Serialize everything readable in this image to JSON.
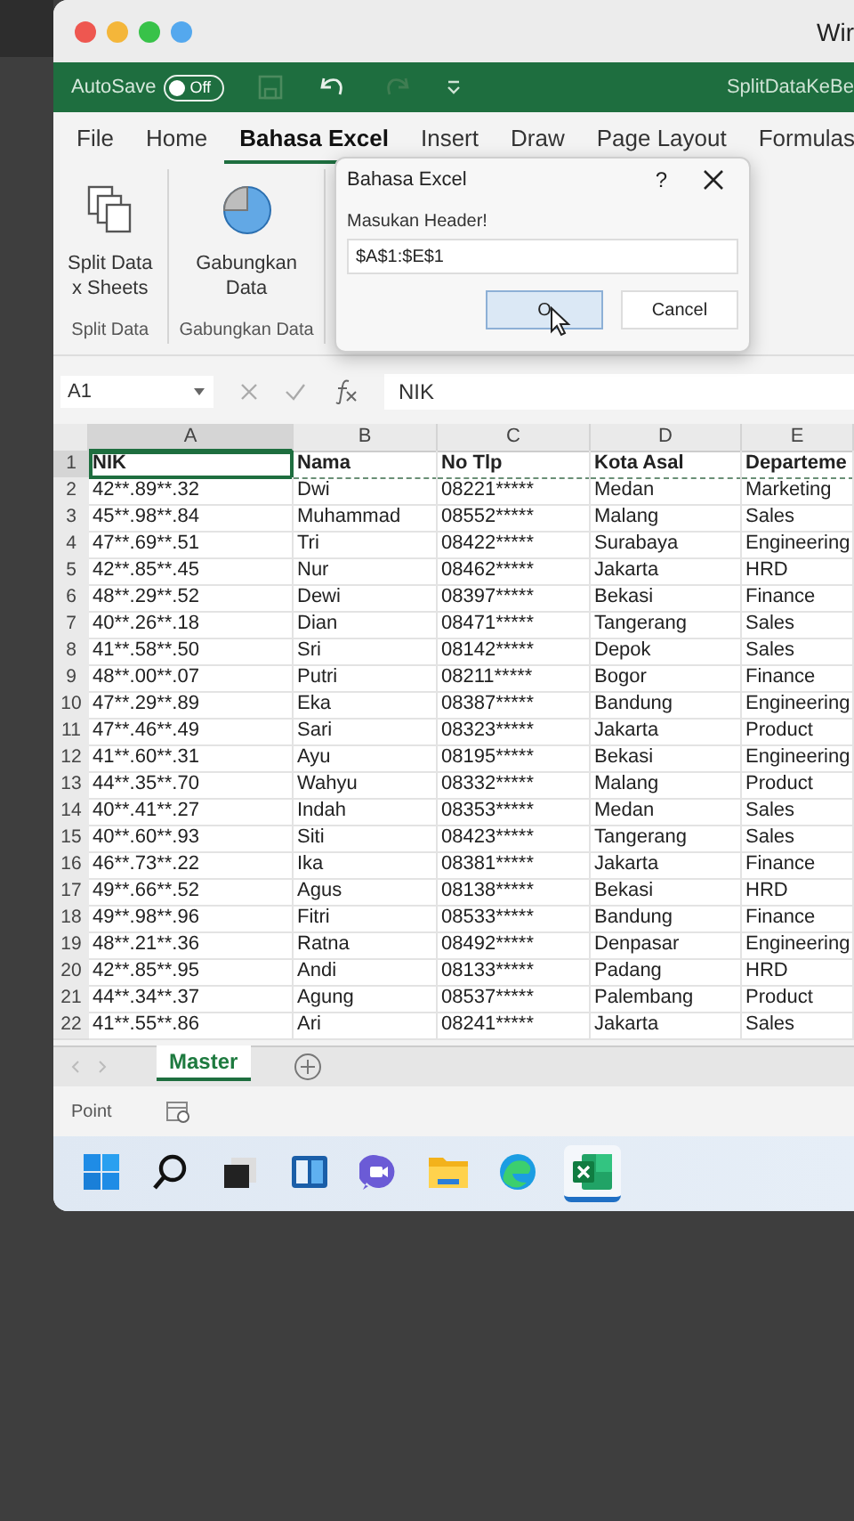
{
  "window": {
    "title": "Wir"
  },
  "quick_access": {
    "autosave_label": "AutoSave",
    "autosave_on": false,
    "autosave_state": "Off",
    "document_title": "SplitDataKeBe"
  },
  "ribbon_tabs": [
    {
      "label": "File",
      "selected": false
    },
    {
      "label": "Home",
      "selected": false
    },
    {
      "label": "Bahasa Excel",
      "selected": true
    },
    {
      "label": "Insert",
      "selected": false
    },
    {
      "label": "Draw",
      "selected": false
    },
    {
      "label": "Page Layout",
      "selected": false
    },
    {
      "label": "Formulas",
      "selected": false
    }
  ],
  "ribbon_groups": [
    {
      "kind": "sheets",
      "button_lines": [
        "Split Data",
        "x Sheets"
      ],
      "group_label": "Split Data"
    },
    {
      "kind": "pie",
      "button_lines": [
        "Gabungkan",
        "Data"
      ],
      "group_label": "Gabungkan Data"
    }
  ],
  "dialog": {
    "title": "Bahasa Excel",
    "help": "?",
    "prompt": "Masukan Header!",
    "value": "$A$1:$E$1",
    "buttons": [
      {
        "label": "O",
        "kind": "primary"
      },
      {
        "label": "Cancel",
        "kind": "secondary"
      }
    ]
  },
  "formula_bar": {
    "name_box": "A1",
    "formula": "NIK"
  },
  "sheet": {
    "columns": [
      {
        "letter": "A",
        "selected": true
      },
      {
        "letter": "B",
        "selected": false
      },
      {
        "letter": "C",
        "selected": false
      },
      {
        "letter": "D",
        "selected": false
      },
      {
        "letter": "E",
        "selected": false
      }
    ],
    "rows": [
      {
        "number": "1",
        "selected": true,
        "kind": "header",
        "cells": [
          "NIK",
          "Nama",
          "No Tlp",
          "Kota Asal",
          "Departeme"
        ]
      },
      {
        "number": "2",
        "selected": false,
        "kind": "data",
        "cells": [
          "42**.89**.32",
          "Dwi",
          "08221*****",
          "Medan",
          "Marketing"
        ]
      },
      {
        "number": "3",
        "selected": false,
        "kind": "data",
        "cells": [
          "45**.98**.84",
          "Muhammad",
          "08552*****",
          "Malang",
          "Sales"
        ]
      },
      {
        "number": "4",
        "selected": false,
        "kind": "data",
        "cells": [
          "47**.69**.51",
          "Tri",
          "08422*****",
          "Surabaya",
          "Engineering"
        ]
      },
      {
        "number": "5",
        "selected": false,
        "kind": "data",
        "cells": [
          "42**.85**.45",
          "Nur",
          "08462*****",
          "Jakarta",
          "HRD"
        ]
      },
      {
        "number": "6",
        "selected": false,
        "kind": "data",
        "cells": [
          "48**.29**.52",
          "Dewi",
          "08397*****",
          "Bekasi",
          "Finance"
        ]
      },
      {
        "number": "7",
        "selected": false,
        "kind": "data",
        "cells": [
          "40**.26**.18",
          "Dian",
          "08471*****",
          "Tangerang",
          "Sales"
        ]
      },
      {
        "number": "8",
        "selected": false,
        "kind": "data",
        "cells": [
          "41**.58**.50",
          "Sri",
          "08142*****",
          "Depok",
          "Sales"
        ]
      },
      {
        "number": "9",
        "selected": false,
        "kind": "data",
        "cells": [
          "48**.00**.07",
          "Putri",
          "08211*****",
          "Bogor",
          "Finance"
        ]
      },
      {
        "number": "10",
        "selected": false,
        "kind": "data",
        "cells": [
          "47**.29**.89",
          "Eka",
          "08387*****",
          "Bandung",
          "Engineering"
        ]
      },
      {
        "number": "11",
        "selected": false,
        "kind": "data",
        "cells": [
          "47**.46**.49",
          "Sari",
          "08323*****",
          "Jakarta",
          "Product"
        ]
      },
      {
        "number": "12",
        "selected": false,
        "kind": "data",
        "cells": [
          "41**.60**.31",
          "Ayu",
          "08195*****",
          "Bekasi",
          "Engineering"
        ]
      },
      {
        "number": "13",
        "selected": false,
        "kind": "data",
        "cells": [
          "44**.35**.70",
          "Wahyu",
          "08332*****",
          "Malang",
          "Product"
        ]
      },
      {
        "number": "14",
        "selected": false,
        "kind": "data",
        "cells": [
          "40**.41**.27",
          "Indah",
          "08353*****",
          "Medan",
          "Sales"
        ]
      },
      {
        "number": "15",
        "selected": false,
        "kind": "data",
        "cells": [
          "40**.60**.93",
          "Siti",
          "08423*****",
          "Tangerang",
          "Sales"
        ]
      },
      {
        "number": "16",
        "selected": false,
        "kind": "data",
        "cells": [
          "46**.73**.22",
          "Ika",
          "08381*****",
          "Jakarta",
          "Finance"
        ]
      },
      {
        "number": "17",
        "selected": false,
        "kind": "data",
        "cells": [
          "49**.66**.52",
          "Agus",
          "08138*****",
          "Bekasi",
          "HRD"
        ]
      },
      {
        "number": "18",
        "selected": false,
        "kind": "data",
        "cells": [
          "49**.98**.96",
          "Fitri",
          "08533*****",
          "Bandung",
          "Finance"
        ]
      },
      {
        "number": "19",
        "selected": false,
        "kind": "data",
        "cells": [
          "48**.21**.36",
          "Ratna",
          "08492*****",
          "Denpasar",
          "Engineering"
        ]
      },
      {
        "number": "20",
        "selected": false,
        "kind": "data",
        "cells": [
          "42**.85**.95",
          "Andi",
          "08133*****",
          "Padang",
          "HRD"
        ]
      },
      {
        "number": "21",
        "selected": false,
        "kind": "data",
        "cells": [
          "44**.34**.37",
          "Agung",
          "08537*****",
          "Palembang",
          "Product"
        ]
      },
      {
        "number": "22",
        "selected": false,
        "kind": "data",
        "cells": [
          "41**.55**.86",
          "Ari",
          "08241*****",
          "Jakarta",
          "Sales"
        ]
      }
    ]
  },
  "sheet_tabs": [
    {
      "label": "Master",
      "selected": true
    }
  ],
  "status_bar": {
    "mode": "Point"
  },
  "taskbar": [
    {
      "kind": "start",
      "selected": false
    },
    {
      "kind": "search",
      "selected": false
    },
    {
      "kind": "taskview",
      "selected": false
    },
    {
      "kind": "widgets",
      "selected": false
    },
    {
      "kind": "chat",
      "selected": false
    },
    {
      "kind": "folder",
      "selected": false
    },
    {
      "kind": "browser",
      "selected": false
    },
    {
      "kind": "excel",
      "selected": true
    }
  ]
}
